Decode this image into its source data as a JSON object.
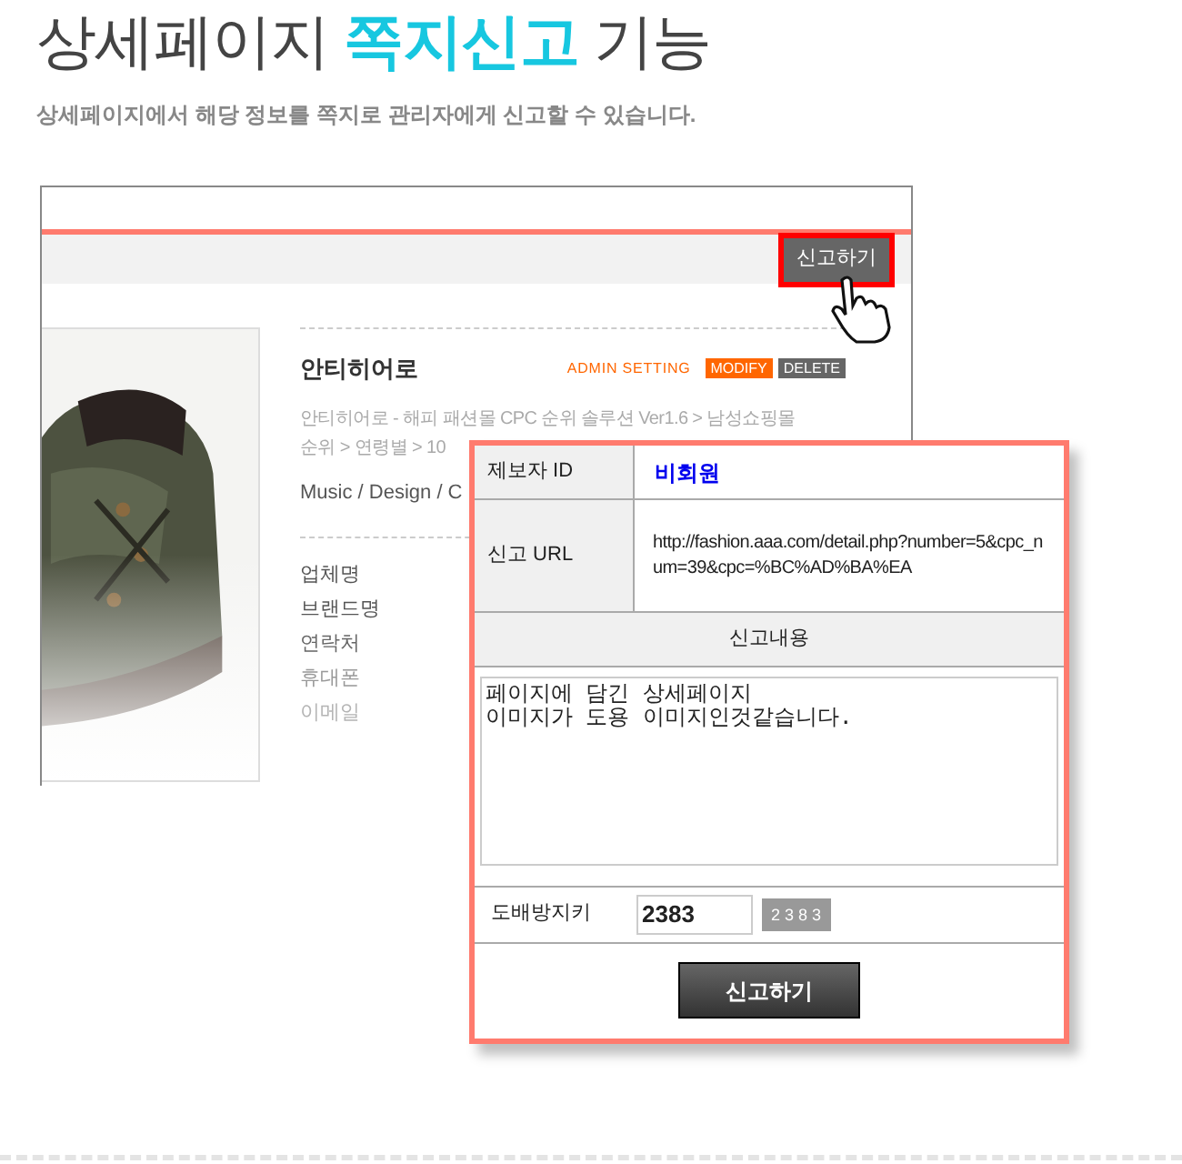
{
  "title": {
    "before": "상세페이지",
    "highlight": "쪽지신고",
    "after": "기능"
  },
  "subtitle": "상세페이지에서 해당 정보를 쪽지로 관리자에게 신고할 수 있습니다.",
  "page": {
    "report_button": "신고하기",
    "product": {
      "name": "안티히어로",
      "admin_label": "ADMIN SETTING",
      "modify": "MODIFY",
      "delete": "DELETE",
      "breadcrumb": [
        "안티히어로 - 해피 패션몰 CPC 순위 솔루션 Ver1.6 > 남성쇼핑몰",
        "순위 > 연령별 > 10"
      ],
      "tags": "Music / Design / C",
      "fields": [
        "업체명",
        "브랜드명",
        "연락처",
        "휴대폰",
        "이메일"
      ]
    }
  },
  "report_popup": {
    "reporter_label": "제보자 ID",
    "reporter": "비회원",
    "url_label": "신고 URL",
    "url": "http://fashion.aaa.com/detail.php?number=5&cpc_num=39&cpc=%BC%AD%BA%EA",
    "content_label": "신고내용",
    "content": "페이지에 담긴 상세페이지\n이미지가 도용 이미지인것같습니다.",
    "captcha_label": "도배방지키",
    "captcha_value": "2383",
    "captcha_code": "2 3 8 3",
    "submit": "신고하기"
  }
}
